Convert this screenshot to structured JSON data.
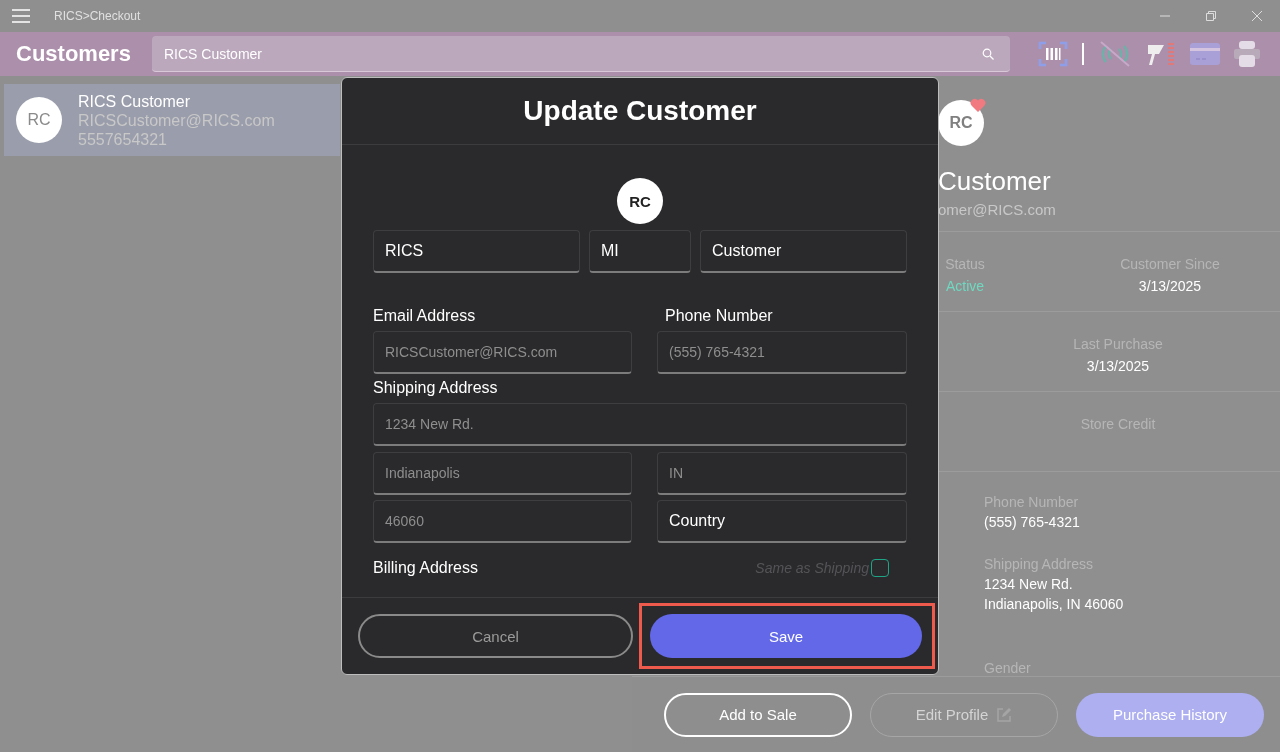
{
  "window": {
    "title": "RICS>Checkout"
  },
  "header": {
    "title": "Customers",
    "search": {
      "value": "RICS Customer"
    }
  },
  "customer_list": [
    {
      "initials": "RC",
      "name": "RICS Customer",
      "email": "RICSCustomer@RICS.com",
      "phone": "5557654321",
      "selected": true
    }
  ],
  "details": {
    "initials": "RC",
    "favorite": true,
    "name": "Customer",
    "email": "omer@RICS.com",
    "status": {
      "label": "Status",
      "value": "Active"
    },
    "customer_since": {
      "label": "Customer Since",
      "value": "3/13/2025"
    },
    "last_purchase": {
      "label": "Last Purchase",
      "value": "3/13/2025"
    },
    "store_credit": {
      "label": "Store Credit"
    },
    "phone": {
      "label": "Phone Number",
      "value": "(555) 765-4321"
    },
    "shipping": {
      "label": "Shipping Address",
      "lines": [
        "1234 New Rd.",
        "Indianapolis, IN 46060"
      ]
    },
    "gender": {
      "label": "Gender"
    }
  },
  "actions": [
    {
      "label": "Add to Sale",
      "kind": "outline",
      "disabled": false
    },
    {
      "label": "Edit Profile",
      "kind": "outline",
      "disabled": true
    },
    {
      "label": "Purchase History",
      "kind": "primary",
      "disabled": false
    }
  ],
  "dialog": {
    "title": "Update Customer",
    "initials": "RC",
    "name_fields": [
      {
        "value": "RICS"
      },
      {
        "value": "MI"
      },
      {
        "value": "Customer"
      }
    ],
    "email": {
      "label": "Email Address",
      "placeholder": "RICSCustomer@RICS.com"
    },
    "phone": {
      "label": "Phone Number",
      "placeholder": "(555) 765-4321"
    },
    "shipping": {
      "label": "Shipping Address",
      "fields": [
        {
          "placeholder": "1234 New Rd."
        },
        {
          "placeholder": "Indianapolis"
        },
        {
          "placeholder": "IN"
        },
        {
          "placeholder": "46060"
        },
        {
          "value": "Country"
        }
      ]
    },
    "billing": {
      "label": "Billing Address",
      "same_as_shipping": {
        "label": "Same as Shipping",
        "checked": false
      }
    },
    "buttons": [
      {
        "label": "Cancel",
        "kind": "secondary",
        "highlighted": false
      },
      {
        "label": "Save",
        "kind": "primary",
        "highlighted": true
      }
    ]
  }
}
